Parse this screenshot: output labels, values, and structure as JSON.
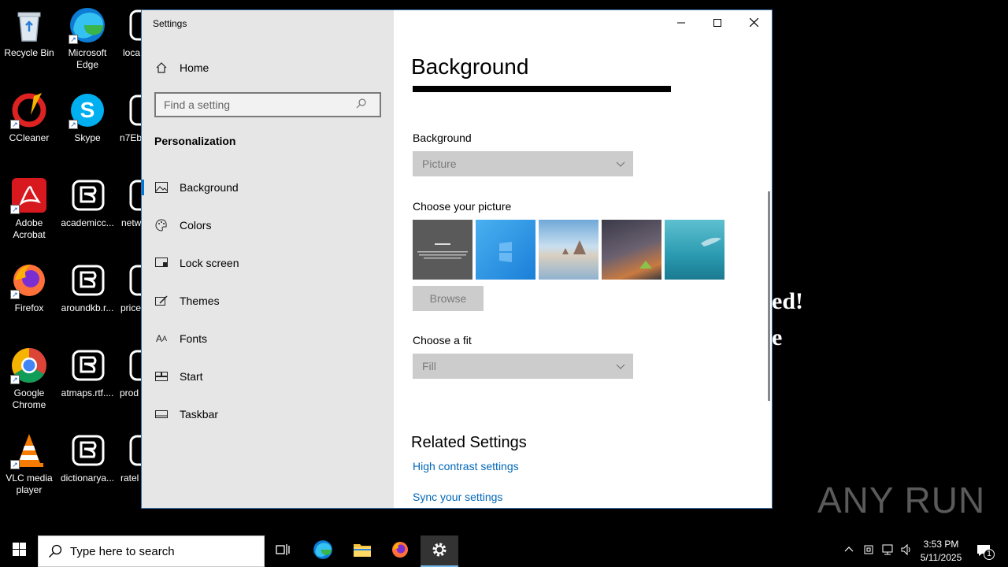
{
  "desktop": {
    "icons_col1": [
      {
        "label": "Recycle Bin",
        "icon": "recycle-bin-icon"
      },
      {
        "label": "CCleaner",
        "icon": "ccleaner-icon"
      },
      {
        "label": "Adobe\nAcrobat",
        "icon": "adobe-acrobat-icon"
      },
      {
        "label": "Firefox",
        "icon": "firefox-icon"
      },
      {
        "label": "Google\nChrome",
        "icon": "chrome-icon"
      },
      {
        "label": "VLC media\nplayer",
        "icon": "vlc-icon"
      }
    ],
    "icons_col2": [
      {
        "label": "Microsoft\nEdge",
        "icon": "edge-icon"
      },
      {
        "label": "Skype",
        "icon": "skype-icon"
      },
      {
        "label": "academicc...",
        "icon": "encrypted-file-icon"
      },
      {
        "label": "aroundkb.r...",
        "icon": "encrypted-file-icon"
      },
      {
        "label": "atmaps.rtf....",
        "icon": "encrypted-file-icon"
      },
      {
        "label": "dictionarya...",
        "icon": "encrypted-file-icon"
      }
    ],
    "icons_col3": [
      {
        "label": "loca",
        "icon": "encrypted-file-icon"
      },
      {
        "label": "n7Eb",
        "icon": "encrypted-file-icon"
      },
      {
        "label": "netw",
        "icon": "encrypted-file-icon"
      },
      {
        "label": "price",
        "icon": "encrypted-file-icon"
      },
      {
        "label": "prod",
        "icon": "encrypted-file-icon"
      },
      {
        "label": "ratel",
        "icon": "encrypted-file-icon"
      }
    ],
    "ransom_line1": "ed!",
    "ransom_line2": "e",
    "watermark": "ANY RUN"
  },
  "settings": {
    "window_title": "Settings",
    "home_label": "Home",
    "search_placeholder": "Find a setting",
    "section_title": "Personalization",
    "nav_items": [
      {
        "label": "Background",
        "icon": "picture-icon",
        "active": true
      },
      {
        "label": "Colors",
        "icon": "palette-icon",
        "active": false
      },
      {
        "label": "Lock screen",
        "icon": "lock-screen-icon",
        "active": false
      },
      {
        "label": "Themes",
        "icon": "themes-icon",
        "active": false
      },
      {
        "label": "Fonts",
        "icon": "fonts-icon",
        "active": false
      },
      {
        "label": "Start",
        "icon": "start-icon",
        "active": false
      },
      {
        "label": "Taskbar",
        "icon": "taskbar-icon",
        "active": false
      }
    ],
    "page_title": "Background",
    "background_label": "Background",
    "background_value": "Picture",
    "choose_picture_label": "Choose your picture",
    "browse_label": "Browse",
    "choose_fit_label": "Choose a fit",
    "fit_value": "Fill",
    "related_title": "Related Settings",
    "link_high_contrast": "High contrast settings",
    "link_sync": "Sync your settings"
  },
  "taskbar": {
    "search_placeholder": "Type here to search",
    "time": "3:53 PM",
    "date": "5/11/2025",
    "notification_count": "1"
  },
  "colors": {
    "accent": "#0078d7",
    "link": "#0067b8",
    "nav_bg": "#e6e6e6",
    "disabled_bg": "#cccccc"
  }
}
